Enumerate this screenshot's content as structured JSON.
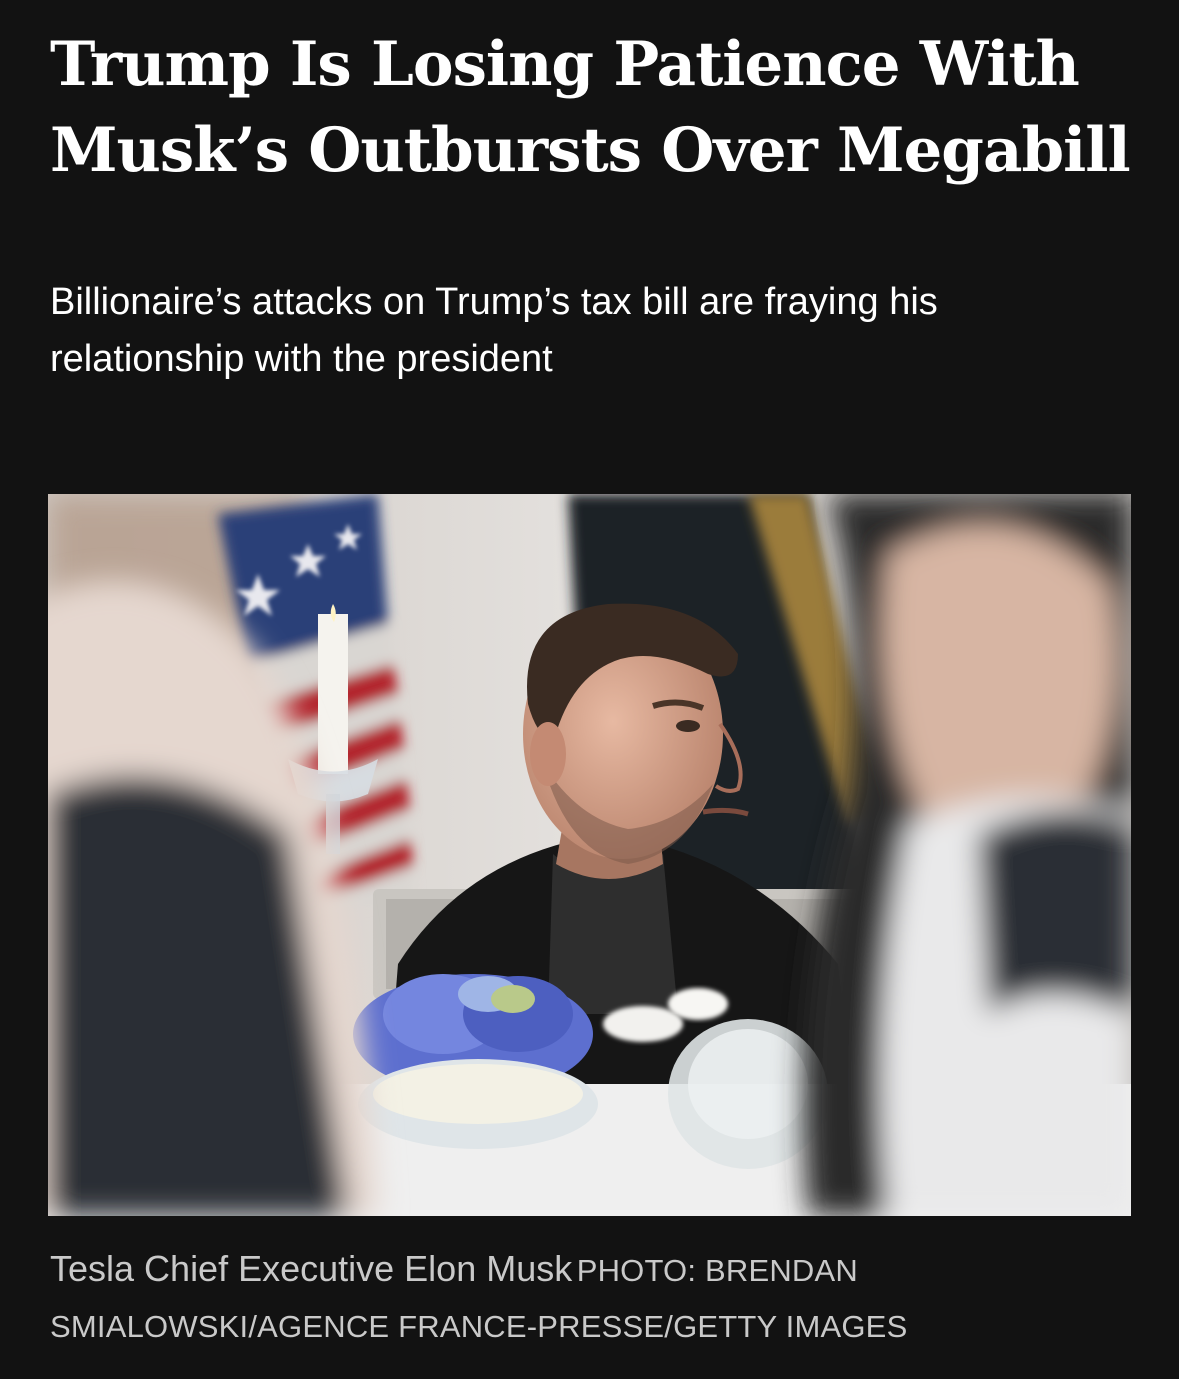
{
  "article": {
    "headline": "Trump Is Losing Patience With Musk’s Outbursts Over Megabill",
    "dek": "Billionaire’s attacks on Trump’s tax bill are fraying his relationship with the president",
    "photo": {
      "caption": "Tesla Chief Executive Elon Musk",
      "credit": "PHOTO: BRENDAN SMIALOWSKI/AGENCE FRANCE-PRESSE/GETTY IMAGES"
    }
  },
  "theme": {
    "background": "#121212",
    "text": "#ffffff",
    "caption": "#c9c9c9"
  }
}
